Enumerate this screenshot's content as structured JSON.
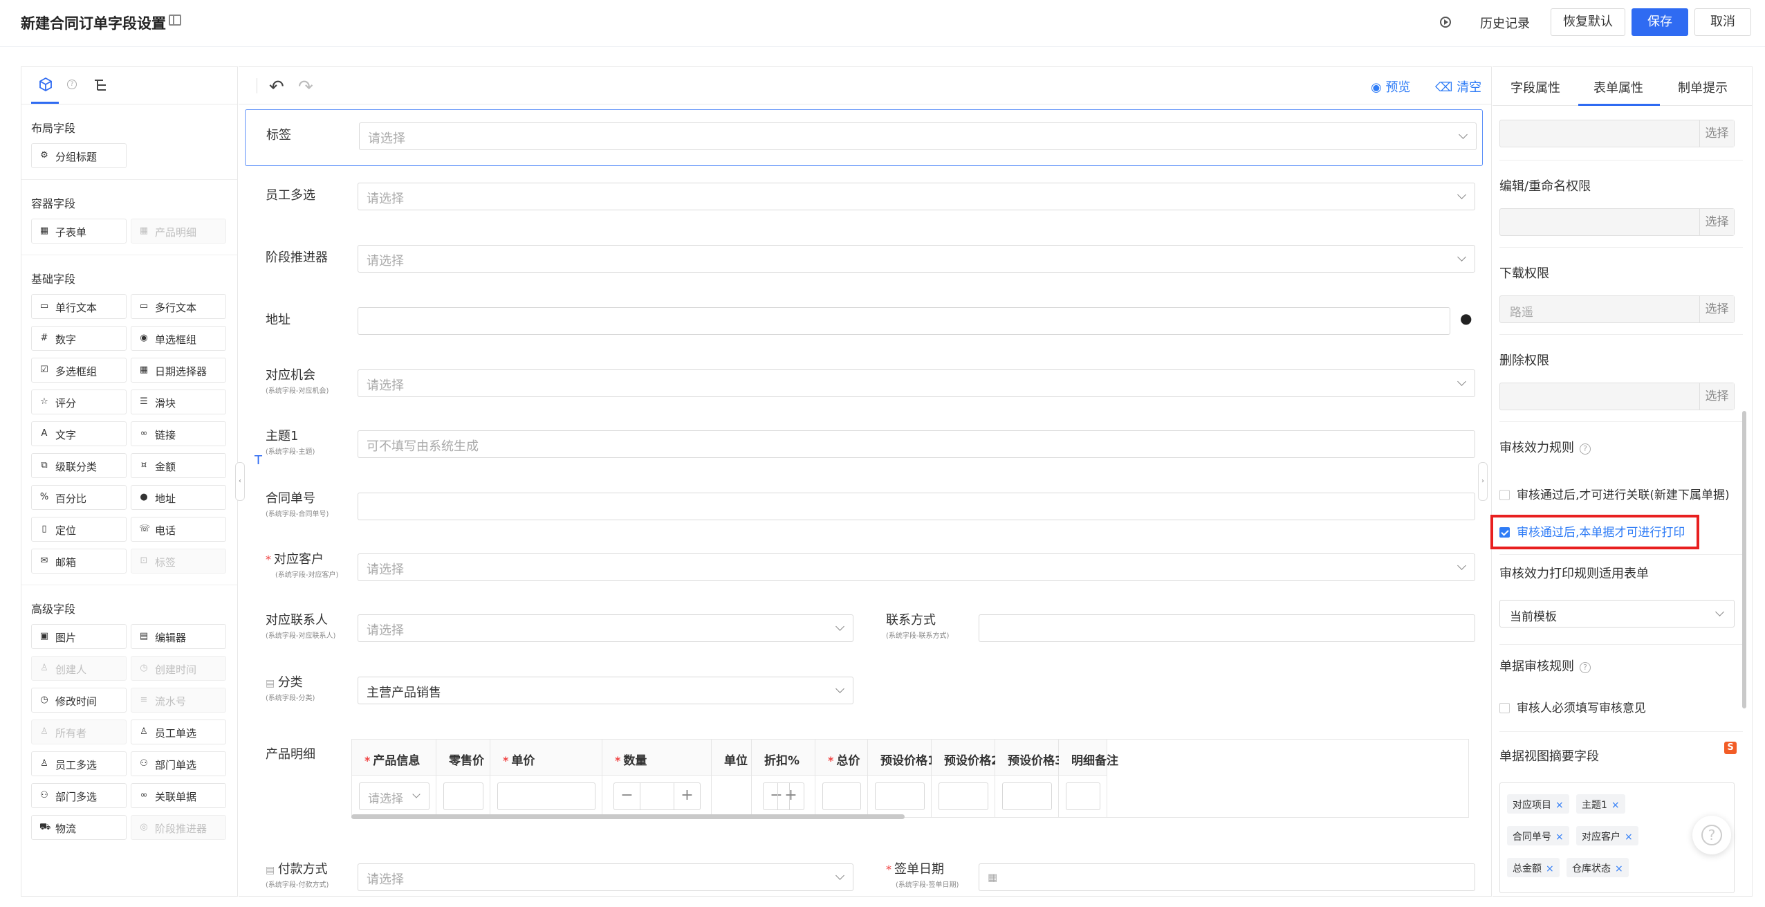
{
  "header": {
    "title": "新建合同订单字段设置",
    "history": "历史记录",
    "restore": "恢复默认",
    "save": "保存",
    "cancel": "取消"
  },
  "left_panel": {
    "sections": [
      {
        "title": "布局字段",
        "items": [
          {
            "label": "分组标题",
            "icon": "group-title-icon",
            "disabled": false
          }
        ]
      },
      {
        "title": "容器字段",
        "items": [
          {
            "label": "子表单",
            "icon": "table-icon",
            "disabled": false
          },
          {
            "label": "产品明细",
            "icon": "table-icon",
            "disabled": true
          }
        ]
      },
      {
        "title": "基础字段",
        "items": [
          {
            "label": "单行文本",
            "icon": "input-icon",
            "disabled": false
          },
          {
            "label": "多行文本",
            "icon": "textarea-icon",
            "disabled": false
          },
          {
            "label": "数字",
            "icon": "number-icon",
            "disabled": false
          },
          {
            "label": "单选框组",
            "icon": "radio-icon",
            "disabled": false
          },
          {
            "label": "多选框组",
            "icon": "checkbox-icon",
            "disabled": false
          },
          {
            "label": "日期选择器",
            "icon": "calendar-icon",
            "disabled": false
          },
          {
            "label": "评分",
            "icon": "star-icon",
            "disabled": false
          },
          {
            "label": "滑块",
            "icon": "slider-icon",
            "disabled": false
          },
          {
            "label": "文字",
            "icon": "text-icon",
            "disabled": false
          },
          {
            "label": "链接",
            "icon": "link-icon",
            "disabled": false
          },
          {
            "label": "级联分类",
            "icon": "cascade-icon",
            "disabled": false
          },
          {
            "label": "金额",
            "icon": "money-icon",
            "disabled": false
          },
          {
            "label": "百分比",
            "icon": "percent-icon",
            "disabled": false
          },
          {
            "label": "地址",
            "icon": "location-pin-icon",
            "disabled": false
          },
          {
            "label": "定位",
            "icon": "locate-icon",
            "disabled": false
          },
          {
            "label": "电话",
            "icon": "phone-icon",
            "disabled": false
          },
          {
            "label": "邮箱",
            "icon": "mail-icon",
            "disabled": false
          },
          {
            "label": "标签",
            "icon": "tag-icon",
            "disabled": true
          }
        ]
      },
      {
        "title": "高级字段",
        "items": [
          {
            "label": "图片",
            "icon": "image-icon",
            "disabled": false
          },
          {
            "label": "编辑器",
            "icon": "editor-icon",
            "disabled": false
          },
          {
            "label": "创建人",
            "icon": "user-icon",
            "disabled": true
          },
          {
            "label": "创建时间",
            "icon": "clock-icon",
            "disabled": true
          },
          {
            "label": "修改时间",
            "icon": "clock-icon",
            "disabled": false
          },
          {
            "label": "流水号",
            "icon": "serial-icon",
            "disabled": true
          },
          {
            "label": "所有者",
            "icon": "user-icon",
            "disabled": true
          },
          {
            "label": "员工单选",
            "icon": "user-icon",
            "disabled": false
          },
          {
            "label": "员工多选",
            "icon": "users-icon",
            "disabled": false
          },
          {
            "label": "部门单选",
            "icon": "org-icon",
            "disabled": false
          },
          {
            "label": "部门多选",
            "icon": "org-icon",
            "disabled": false
          },
          {
            "label": "关联单据",
            "icon": "link-icon",
            "disabled": false
          },
          {
            "label": "物流",
            "icon": "truck-icon",
            "disabled": false
          },
          {
            "label": "阶段推进器",
            "icon": "stage-icon",
            "disabled": true
          }
        ]
      }
    ]
  },
  "canvas": {
    "toolbar": {
      "preview": "预览",
      "clear": "清空"
    },
    "fields": {
      "tag": {
        "label": "标签",
        "placeholder": "请选择"
      },
      "staff_multi": {
        "label": "员工多选",
        "placeholder": "请选择"
      },
      "stage": {
        "label": "阶段推进器",
        "placeholder": "请选择"
      },
      "address": {
        "label": "地址",
        "placeholder": ""
      },
      "opportunity": {
        "label": "对应机会",
        "sub": "(系统字段-对应机会)",
        "placeholder": "请选择"
      },
      "subject": {
        "label": "主题1",
        "sub": "(系统字段-主题)",
        "placeholder": "可不填写由系统生成"
      },
      "contract_no": {
        "label": "合同单号",
        "sub": "(系统字段-合同单号)",
        "placeholder": ""
      },
      "customer": {
        "label": "对应客户",
        "sub": "(系统字段-对应客户)",
        "placeholder": "请选择"
      },
      "contact": {
        "label": "对应联系人",
        "sub": "(系统字段-对应联系人)",
        "placeholder": "请选择"
      },
      "contact_method": {
        "label": "联系方式",
        "sub": "(系统字段-联系方式)",
        "placeholder": ""
      },
      "category": {
        "label": "分类",
        "sub": "(系统字段-分类)",
        "value": "主营产品销售"
      },
      "product_detail": {
        "label": "产品明细"
      },
      "payment": {
        "label": "付款方式",
        "sub": "(系统字段-付款方式)",
        "placeholder": "请选择"
      },
      "sign_date": {
        "label": "签单日期",
        "sub": "(系统字段-签单日期)"
      }
    },
    "product_table": {
      "columns": [
        "产品信息",
        "零售价",
        "单价",
        "数量",
        "单位",
        "折扣%",
        "总价",
        "预设价格1",
        "预设价格2",
        "预设价格3",
        "明细备注"
      ],
      "required": [
        true,
        false,
        true,
        true,
        false,
        false,
        true,
        false,
        false,
        false,
        false
      ],
      "select_placeholder": "请选择"
    }
  },
  "right_panel": {
    "tabs": [
      "字段属性",
      "表单属性",
      "制单提示"
    ],
    "active_tab": "表单属性",
    "select_label": "选择",
    "edit_rename_perm": "编辑/重命名权限",
    "download_perm": "下载权限",
    "download_value": "路遥",
    "delete_perm": "删除权限",
    "audit_rules": "审核效力规则",
    "audit_option1": "审核通过后,才可进行关联(新建下属单据)",
    "audit_option2": "审核通过后,本单据才可进行打印",
    "print_rule_form": "审核效力打印规则适用表单",
    "print_rule_value": "当前模板",
    "doc_audit_rules": "单据审核规则",
    "doc_audit_option": "审核人必须填写审核意见",
    "summary_fields": "单据视图摘要字段",
    "summary_tags": [
      "对应项目",
      "主题1",
      "合同单号",
      "对应客户",
      "总金额",
      "仓库状态"
    ]
  }
}
